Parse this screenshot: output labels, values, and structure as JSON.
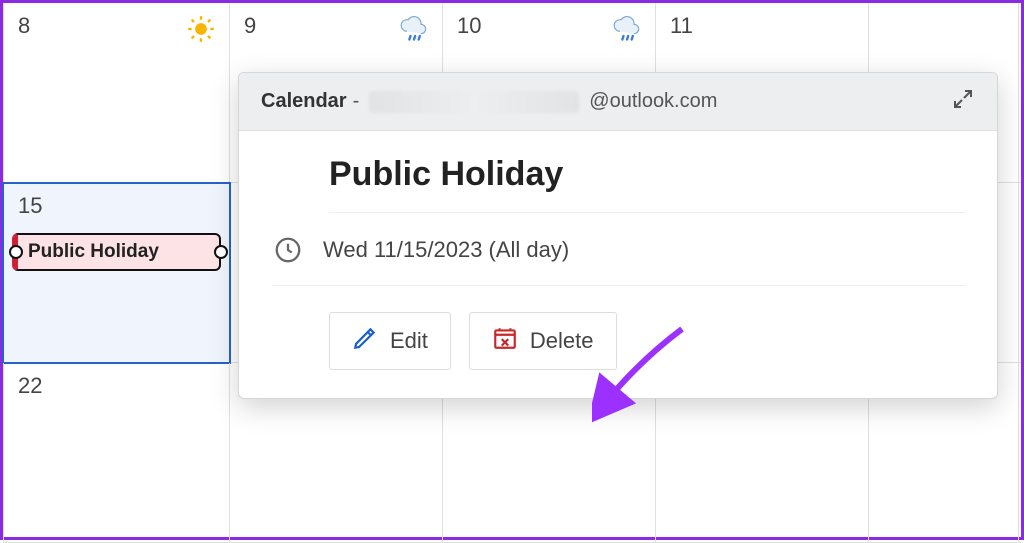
{
  "calendar": {
    "row0": [
      {
        "num": "8",
        "weather": "sunny"
      },
      {
        "num": "9",
        "weather": "rain"
      },
      {
        "num": "10",
        "weather": "rain"
      },
      {
        "num": "11",
        "weather": null
      },
      {
        "num": "",
        "weather": null
      }
    ],
    "row1": [
      {
        "num": "15",
        "weather": null,
        "event": "Public Holiday"
      },
      {
        "num": "",
        "weather": null
      },
      {
        "num": "",
        "weather": null
      },
      {
        "num": "",
        "weather": null
      },
      {
        "num": "",
        "weather": null
      }
    ],
    "row2": [
      {
        "num": "22",
        "weather": null
      },
      {
        "num": "",
        "weather": null
      },
      {
        "num": "",
        "weather": null
      },
      {
        "num": "",
        "weather": null
      },
      {
        "num": "",
        "weather": null
      }
    ]
  },
  "popup": {
    "header_calendar": "Calendar",
    "header_dash": " - ",
    "header_email": "@outlook.com",
    "title": "Public Holiday",
    "date": "Wed 11/15/2023 (All day)",
    "edit_label": "Edit",
    "delete_label": "Delete"
  }
}
